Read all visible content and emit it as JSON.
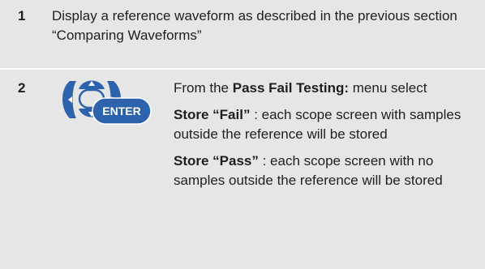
{
  "step1": {
    "number": "1",
    "text": "Display a reference waveform as described in the previous section “Comparing Waveforms”"
  },
  "step2": {
    "number": "2",
    "button_label": "ENTER",
    "intro_prefix": "From the ",
    "intro_bold": "Pass Fail Testing:",
    "intro_suffix": " menu select",
    "fail_bold": "Store “Fail”",
    "fail_text": " : each scope screen with samples outside the reference will be stored",
    "pass_bold": "Store “Pass”",
    "pass_text": " : each scope screen with no samples outside the reference will be stored"
  },
  "colors": {
    "row_background": "#e6e6e6",
    "button_blue": "#2d63ad",
    "text": "#1f1f1f"
  },
  "icons": [
    "navigation-arrow-keys-icon",
    "enter-button-icon"
  ]
}
